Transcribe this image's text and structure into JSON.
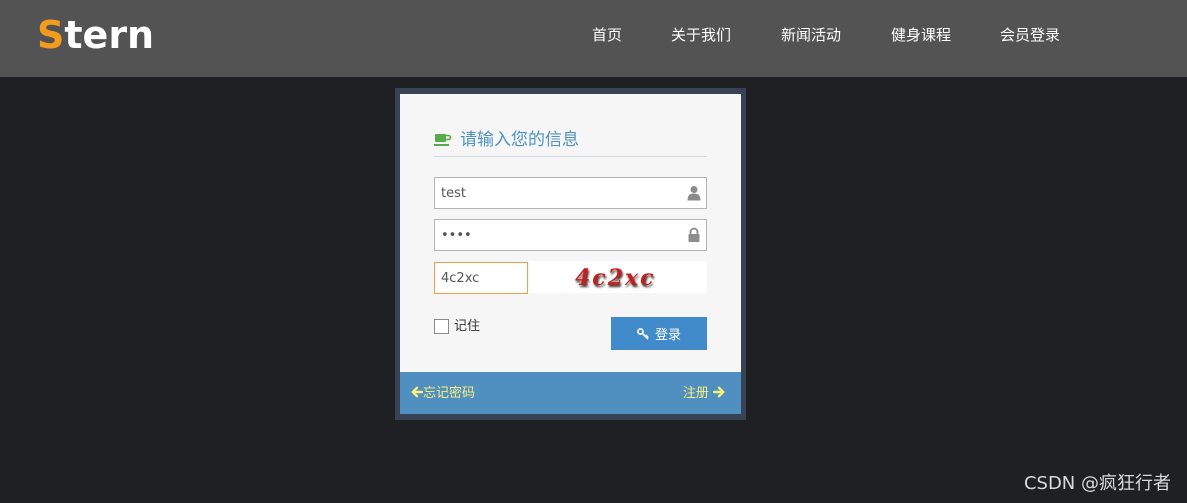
{
  "brand": {
    "logo_first": "S",
    "logo_rest": "tern",
    "accent_color": "#f29c1f"
  },
  "nav": {
    "items": [
      {
        "label": "首页"
      },
      {
        "label": "关于我们"
      },
      {
        "label": "新闻活动"
      },
      {
        "label": "健身课程"
      },
      {
        "label": "会员登录"
      }
    ]
  },
  "login": {
    "heading": "请输入您的信息",
    "username": {
      "value": "test",
      "icon": "user-icon"
    },
    "password": {
      "value": "••••",
      "icon": "lock-icon"
    },
    "captcha": {
      "value": "4c2xc",
      "image_text": "4c2xc"
    },
    "remember_label": "记住",
    "remember_checked": false,
    "submit_label": "登录",
    "submit_color": "#428bca"
  },
  "footer": {
    "forgot_label": "忘记密码",
    "register_label": "注册",
    "link_color": "#fcf07f",
    "bg_color": "#5090c1"
  },
  "watermark": "CSDN @疯狂行者"
}
